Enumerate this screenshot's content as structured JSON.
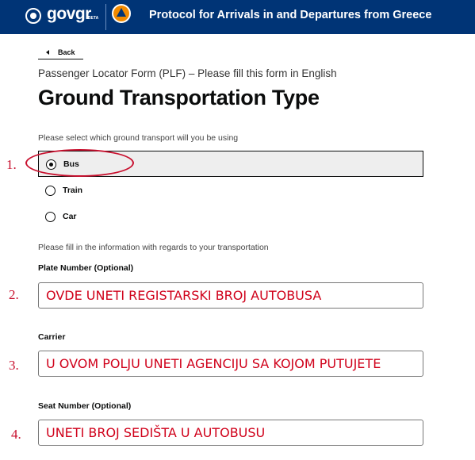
{
  "header": {
    "logo_text": "govgr",
    "beta": "BETA",
    "title": "Protocol for Arrivals in and Departures from Greece",
    "bg_color": "#003476"
  },
  "back": {
    "label": "Back",
    "icon": "chevron-left-icon"
  },
  "caption": "Passenger Locator Form (PLF) – Please fill this form in English",
  "title": "Ground Transportation Type",
  "transport": {
    "hint": "Please select which ground transport will you be using",
    "selected": "Bus",
    "options": [
      {
        "label": "Bus",
        "checked": true
      },
      {
        "label": "Train",
        "checked": false
      },
      {
        "label": "Car",
        "checked": false
      }
    ]
  },
  "info_hint": "Please fill in the information with regards to your transportation",
  "fields": [
    {
      "label": "Plate Number (Optional)",
      "value": "OVDE UNETI REGISTARSKI BROJ AUTOBUSA"
    },
    {
      "label": "Carrier",
      "value": "U OVOM POLJU UNETI AGENCIJU SA KOJOM PUTUJETE"
    },
    {
      "label": "Seat Number (Optional)",
      "value": "UNETI BROJ SEDIŠTA U AUTOBUSU"
    }
  ],
  "annotations": {
    "color": "#c8102e",
    "numbers": [
      "1.",
      "2.",
      "3.",
      "4."
    ]
  }
}
